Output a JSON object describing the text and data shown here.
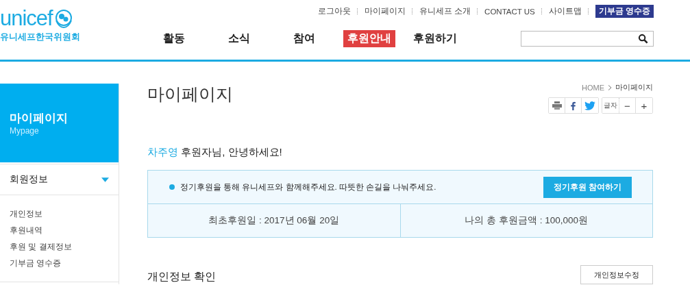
{
  "header": {
    "logo_text": "unicef",
    "logo_subtitle": "유니세프한국위원회",
    "util_links": [
      "로그아웃",
      "마이페이지",
      "유니세프 소개",
      "CONTACT US",
      "사이트맵"
    ],
    "receipt_button": "기부금 영수증",
    "nav": [
      {
        "label": "활동",
        "selected": false
      },
      {
        "label": "소식",
        "selected": false
      },
      {
        "label": "참여",
        "selected": false
      },
      {
        "label": "후원안내",
        "selected": true
      },
      {
        "label": "후원하기",
        "selected": false
      }
    ]
  },
  "sidebar": {
    "title": "마이페이지",
    "subtitle": "Mypage",
    "section": {
      "label": "회원정보",
      "expanded": true
    },
    "items": [
      "개인정보",
      "후원내역",
      "후원 및 결제정보",
      "기부금 영수증"
    ]
  },
  "main": {
    "title": "마이페이지",
    "breadcrumb": [
      "HOME",
      "마이페이지"
    ],
    "font_label": "글자",
    "font_minus": "−",
    "font_plus": "+",
    "greeting_name": "차주영",
    "greeting_text": "후원자님, 안녕하세요!",
    "notice": "정기후원을 통해 유니세프와 함께해주세요. 따뜻한 손길을 나눠주세요.",
    "notice_button": "정기후원 참여하기",
    "stats": [
      "최초후원일 : 2017년 06월 20일",
      "나의 총 후원금액 : 100,000원"
    ],
    "section_title": "개인정보 확인",
    "edit_button": "개인정보수정"
  }
}
